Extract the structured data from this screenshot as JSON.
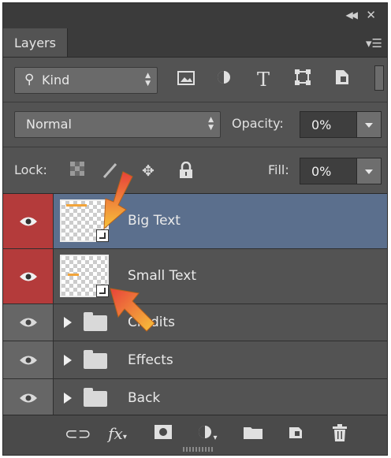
{
  "panel": {
    "tab_label": "Layers"
  },
  "filter": {
    "kind_label": "Kind",
    "icons": [
      "pixel-layer-filter-icon",
      "adjustment-layer-filter-icon",
      "type-layer-filter-icon",
      "shape-layer-filter-icon",
      "smart-object-filter-icon"
    ],
    "type_glyph": "T"
  },
  "blend": {
    "mode": "Normal",
    "opacity_label": "Opacity:",
    "opacity_value": "0%"
  },
  "lock": {
    "label": "Lock:",
    "fill_label": "Fill:",
    "fill_value": "0%"
  },
  "layers": [
    {
      "name": "Big Text",
      "type": "smart-object",
      "selected": true,
      "visible": true
    },
    {
      "name": "Small Text",
      "type": "smart-object",
      "selected": false,
      "visible": true
    },
    {
      "name": "Credits",
      "type": "group",
      "selected": false,
      "visible": true
    },
    {
      "name": "Effects",
      "type": "group",
      "selected": false,
      "visible": true
    },
    {
      "name": "Back",
      "type": "group",
      "selected": false,
      "visible": true
    }
  ],
  "footer": {
    "fx_label": "fx"
  },
  "colors": {
    "panel_bg": "#535353",
    "selected_row": "#5b6f8d",
    "eye_highlight": "#b43b3b",
    "annotation_arrow": "#f4a42c"
  }
}
